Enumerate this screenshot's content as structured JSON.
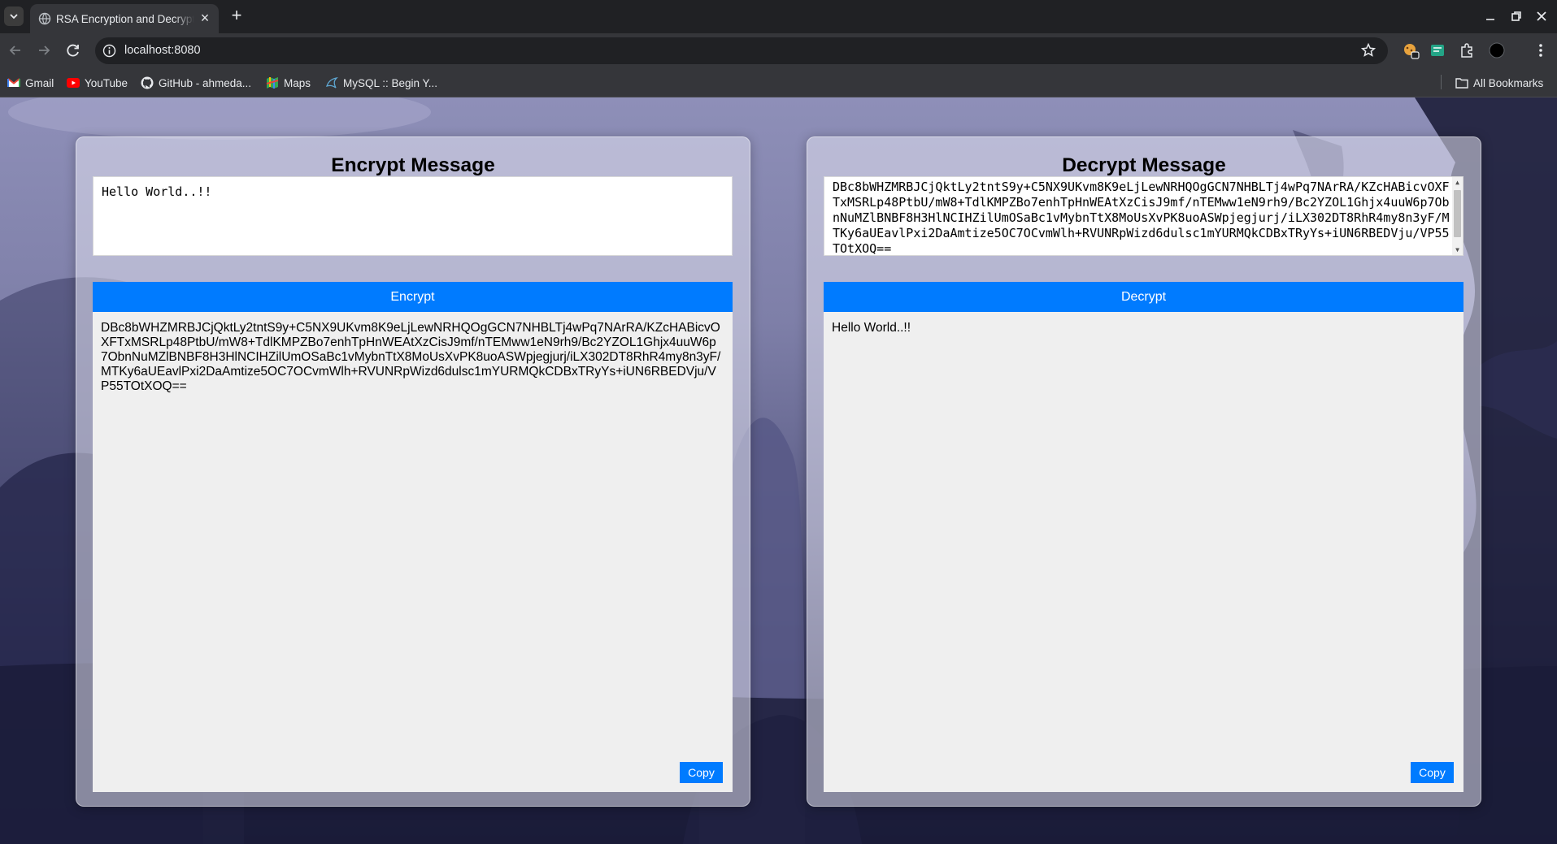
{
  "browser": {
    "tab_title": "RSA Encryption and Decryption",
    "url": "localhost:8080",
    "bookmarks": [
      {
        "label": "Gmail",
        "icon": "gmail-icon"
      },
      {
        "label": "YouTube",
        "icon": "youtube-icon"
      },
      {
        "label": "GitHub - ahmeda...",
        "icon": "github-icon"
      },
      {
        "label": "Maps",
        "icon": "maps-icon"
      },
      {
        "label": "MySQL :: Begin Y...",
        "icon": "mysql-icon"
      }
    ],
    "all_bookmarks": "All Bookmarks"
  },
  "encrypt": {
    "title": "Encrypt Message",
    "input_value": "Hello World..!!",
    "button_label": "Encrypt",
    "output": "DBc8bWHZMRBJCjQktLy2tntS9y+C5NX9UKvm8K9eLjLewNRHQOgGCN7NHBLTj4wPq7NArRA/KZcHABicvOXFTxMSRLp48PtbU/mW8+TdlKMPZBo7enhTpHnWEAtXzCisJ9mf/nTEMww1eN9rh9/Bc2YZOL1Ghjx4uuW6p7ObnNuMZlBNBF8H3HlNCIHZilUmOSaBc1vMybnTtX8MoUsXvPK8uoASWpjegjurj/iLX302DT8RhR4my8n3yF/MTKy6aUEavlPxi2DaAmtize5OC7OCvmWlh+RVUNRpWizd6dulsc1mYURMQkCDBxTRyYs+iUN6RBEDVju/VP55TOtXOQ==",
    "copy_label": "Copy"
  },
  "decrypt": {
    "title": "Decrypt Message",
    "input_value": "DBc8bWHZMRBJCjQktLy2tntS9y+C5NX9UKvm8K9eLjLewNRHQOgGCN7NHBLTj4wPq7NArRA/KZcHABicvOXFTxMSRLp48PtbU/mW8+TdlKMPZBo7enhTpHnWEAtXzCisJ9mf/nTEMww1eN9rh9/Bc2YZOL1Ghjx4uuW6p7ObnNuMZlBNBF8H3HlNCIHZilUmOSaBc1vMybnTtX8MoUsXvPK8uoASWpjegjurj/iLX302DT8RhR4my8n3yF/MTKy6aUEavlPxi2DaAmtize5OC7OCvmWlh+RVUNRpWizd6dulsc1mYURMQkCDBxTRyYs+iUN6RBEDVju/VP55TOtXOQ==",
    "button_label": "Decrypt",
    "output": "Hello World..!!",
    "copy_label": "Copy"
  },
  "colors": {
    "accent": "#007bff",
    "chrome_dark": "#202124",
    "chrome_toolbar": "#35363a"
  }
}
